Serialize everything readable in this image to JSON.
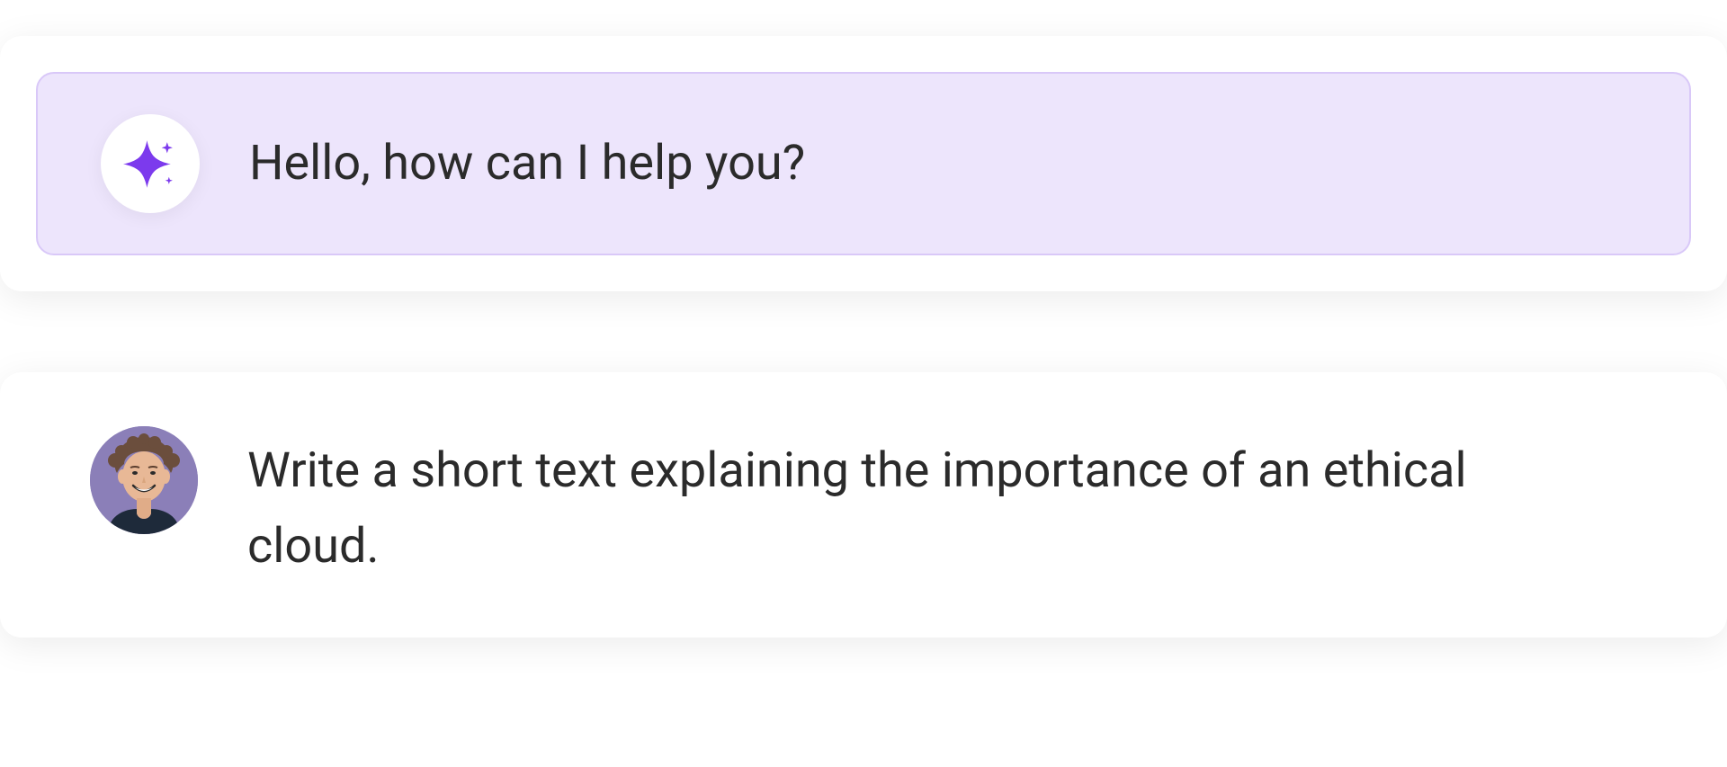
{
  "chat": {
    "ai": {
      "icon": "sparkle-icon",
      "message": "Hello, how can I help you?"
    },
    "user": {
      "avatar": "user-avatar",
      "message": "Write a short text explaining the importance of an ethical cloud."
    }
  },
  "colors": {
    "ai_bg": "#ede5fc",
    "ai_border": "#d9c8f8",
    "accent": "#7c3aed",
    "text": "#2b2b2b",
    "avatar_bg": "#8b7fb8"
  }
}
